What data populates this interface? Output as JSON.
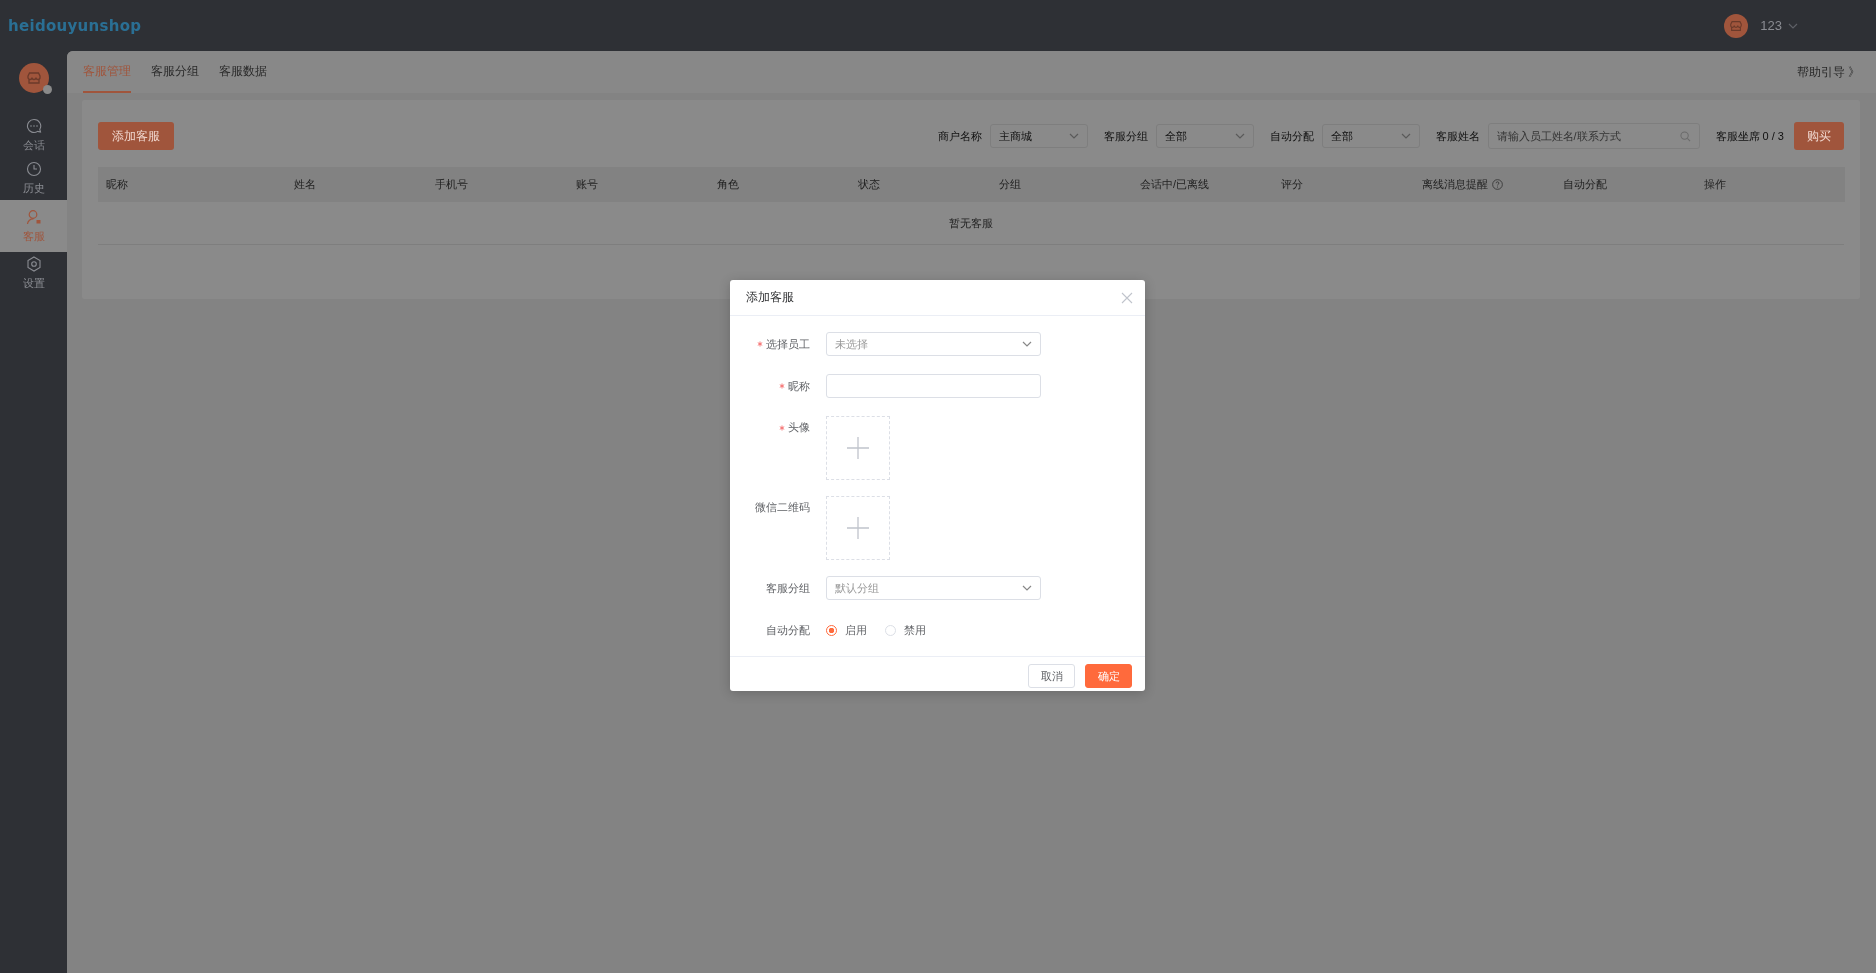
{
  "topbar": {
    "logo": "heidouyunshop",
    "user": "123"
  },
  "sidebar": {
    "items": [
      {
        "label": "会话",
        "selected": false
      },
      {
        "label": "历史",
        "selected": false
      },
      {
        "label": "客服",
        "selected": true
      },
      {
        "label": "设置",
        "selected": false
      }
    ]
  },
  "tabs": [
    {
      "label": "客服管理",
      "selected": true
    },
    {
      "label": "客服分组",
      "selected": false
    },
    {
      "label": "客服数据",
      "selected": false
    }
  ],
  "help_link": "帮助引导 》",
  "toolbar": {
    "add_button": "添加客服",
    "filters": [
      {
        "kind": "select",
        "label": "商户名称",
        "value": "主商城"
      },
      {
        "kind": "select",
        "label": "客服分组",
        "value": "全部"
      },
      {
        "kind": "select",
        "label": "自动分配",
        "value": "全部"
      },
      {
        "kind": "search",
        "label": "客服姓名",
        "placeholder": "请输入员工姓名/联系方式"
      }
    ],
    "seats": "客服坐席 0 / 3",
    "buy_button": "购买"
  },
  "table": {
    "columns": [
      {
        "label": "昵称",
        "help": false
      },
      {
        "label": "姓名",
        "help": false
      },
      {
        "label": "手机号",
        "help": false
      },
      {
        "label": "账号",
        "help": false
      },
      {
        "label": "角色",
        "help": false
      },
      {
        "label": "状态",
        "help": false
      },
      {
        "label": "分组",
        "help": false
      },
      {
        "label": "会话中/已离线",
        "help": false
      },
      {
        "label": "评分",
        "help": false
      },
      {
        "label": "离线消息提醒",
        "help": true
      },
      {
        "label": "自动分配",
        "help": false
      },
      {
        "label": "操作",
        "help": false
      }
    ],
    "empty_text": "暂无客服"
  },
  "dialog": {
    "title": "添加客服",
    "fields": [
      {
        "kind": "select",
        "label": "选择员工",
        "required": true,
        "placeholder": "未选择"
      },
      {
        "kind": "text",
        "label": "昵称",
        "required": true
      },
      {
        "kind": "upload",
        "label": "头像",
        "required": true
      },
      {
        "kind": "upload",
        "label": "微信二维码",
        "required": false
      },
      {
        "kind": "select",
        "label": "客服分组",
        "required": false,
        "placeholder": "默认分组"
      },
      {
        "kind": "radio",
        "label": "自动分配",
        "required": false,
        "options": [
          {
            "label": "启用",
            "selected": true
          },
          {
            "label": "禁用",
            "selected": false
          }
        ]
      }
    ],
    "buttons": [
      {
        "label": "取消",
        "primary": false
      },
      {
        "label": "确定",
        "primary": true
      }
    ]
  }
}
